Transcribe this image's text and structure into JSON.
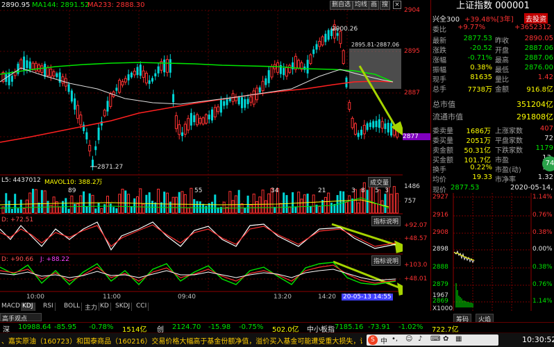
{
  "top_bar": {
    "price": "2890.95",
    "ma144_label": "MA144: 2891.52",
    "ma233_label": "MA233: 2888.30",
    "btn_autoscale": "删自选",
    "btn_periods": "均线",
    "btn_chart": "画",
    "btn_search": "搜"
  },
  "indicator_colors": {
    "ma144": "#00e600",
    "ma233": "#ff3232",
    "kdj_k": "#ffffff",
    "kdj_d": "#ffff00",
    "kdj_j": "#ff40ff"
  },
  "price_labels": {
    "high": "2900.26",
    "low": "2871.27",
    "box": "2895.81-2887.06"
  },
  "axis_labels": [
    "2904",
    "2895",
    "2887",
    "2877",
    "1486",
    "757",
    "+92.07",
    "+48.57",
    "+103.0",
    "+48.01"
  ],
  "volume": {
    "label": "L5: 4437012",
    "mavol": "MAVOL10: 388.2万",
    "turnover_btn": "成交量",
    "markers": [
      "89",
      "55",
      "34",
      "21",
      "3",
      "8",
      "5",
      "3"
    ]
  },
  "kdj_line1": {
    "label": "D: +72.51",
    "button": "指标说明"
  },
  "kdj_line2": {
    "k_label": "D: +90.66",
    "j_label": "J: +88.22",
    "button": "指标说明"
  },
  "time_labels": [
    "10:00",
    "11:00",
    "09:40",
    "13:20",
    "14:20"
  ],
  "crosshair_date": "20-05-13 14:55",
  "bottom_tabs": [
    "MACD",
    "KDJ",
    "RSI",
    "BOLL",
    "主力",
    "KD",
    "SKDJ",
    "CCI"
  ],
  "panel_tab": "高手观点",
  "index": {
    "name": "上证指数",
    "code": "000001",
    "sub_name": "兴全300",
    "sub_change": "+39.48%[3年]",
    "buy_btn": "去投资",
    "weibi_label": "委比",
    "weibi_value": "+9.77%",
    "weicha_value": "+3652312",
    "rows": [
      {
        "l": "最新",
        "v": "2877.53",
        "l2": "昨收",
        "v2": "2890.05"
      },
      {
        "l": "涨跌",
        "v": "-20.52",
        "l2": "开盘",
        "v2": "2887.06"
      },
      {
        "l": "涨幅",
        "v": "-0.71%",
        "l2": "最高",
        "v2": "2887.06"
      },
      {
        "l": "振幅",
        "v": "0.38%",
        "l2": "最低",
        "v2": "2876.00"
      },
      {
        "l": "现手",
        "v": "81635",
        "l2": "量比",
        "v2": "1.42"
      },
      {
        "l": "总手",
        "v": "7738万",
        "l2": "金额",
        "v2": "916.8亿"
      }
    ],
    "market": [
      {
        "l": "总市值",
        "v": "351204亿"
      },
      {
        "l": "流通市值",
        "v": "291808亿"
      }
    ],
    "orders": [
      {
        "l": "委卖量",
        "v": "1686万",
        "l2": "上涨家数",
        "v2": "407"
      },
      {
        "l": "委买量",
        "v": "2051万",
        "l2": "平盘家数",
        "v2": "72"
      },
      {
        "l": "卖金额",
        "v": "50.31亿",
        "l2": "下跌家数",
        "v2": "1179"
      },
      {
        "l": "买金额",
        "v": "101.7亿",
        "l2": "市盈",
        "v2": "13."
      },
      {
        "l": "换手",
        "v": "0.22%",
        "l2": "市盈(动)",
        "v2": "13."
      },
      {
        "l": "均价",
        "v": "19.33",
        "l2": "市净率",
        "v2": "1.32"
      }
    ],
    "now_label": "现价",
    "now_value": "2877.53",
    "date": "2020-05-14,",
    "badge": "74"
  },
  "mini_chart": {
    "y_labels": [
      "2927",
      "2916",
      "2908",
      "2898",
      "2888",
      "2879",
      "2869"
    ],
    "pct_labels": [
      "1.14%",
      "0.76%",
      "0.38%",
      "0.00%",
      "0.38%",
      "0.76%",
      "1.14%"
    ],
    "vol_label": "1967",
    "vol_base": "X1000",
    "tabs": [
      "筹码",
      "火焰"
    ]
  },
  "status_bar": {
    "items": [
      {
        "t": "深",
        "c": "wht"
      },
      {
        "t": "10988.64",
        "c": "grn"
      },
      {
        "t": "-85.95",
        "c": "grn"
      },
      {
        "t": "-0.78%",
        "c": "grn"
      },
      {
        "t": "1514亿",
        "c": "yel"
      },
      {
        "t": "创",
        "c": "wht"
      },
      {
        "t": "2124.70",
        "c": "grn"
      },
      {
        "t": "-15.98",
        "c": "grn"
      },
      {
        "t": "-0.75%",
        "c": "grn"
      },
      {
        "t": "502.0亿",
        "c": "yel"
      },
      {
        "t": "中小板指",
        "c": "wht"
      },
      {
        "t": "7185.16",
        "c": "grn"
      },
      {
        "t": "-73.91",
        "c": "grn"
      },
      {
        "t": "-1.02%",
        "c": "grn"
      },
      {
        "t": "722.7亿",
        "c": "yel"
      }
    ]
  },
  "ticker_text": "、嘉实原油（160723）和国泰商品（160216）交易价格大幅高于基金份额净值，溢价买入基金可能遭受重大损失，请谨",
  "clock": "10:30:52"
}
